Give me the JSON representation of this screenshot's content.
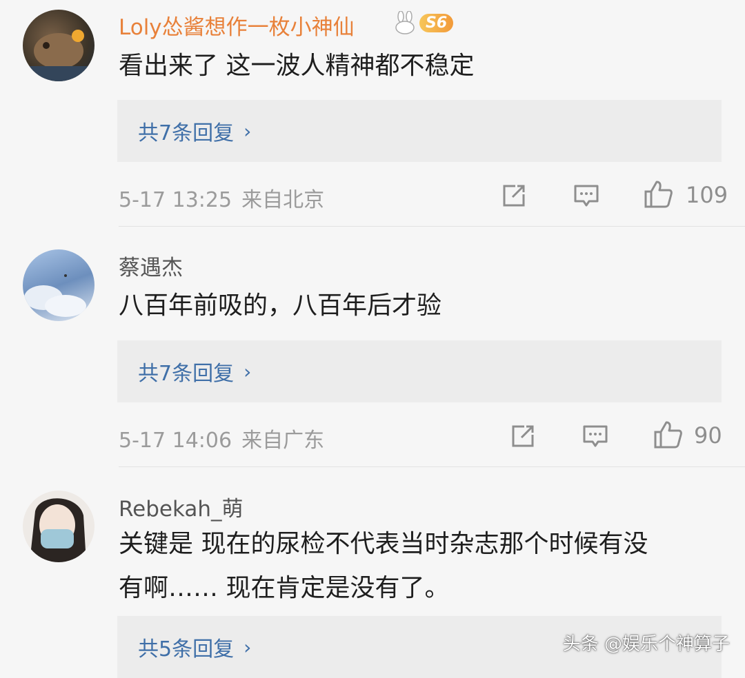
{
  "comments": [
    {
      "username": "Loly怂酱想作一枚小神仙",
      "badge_level": "S6",
      "text": "看出来了 这一波人精神都不稳定",
      "reply_link": "共7条回复",
      "time": "5-17 13:25",
      "location": "来自北京",
      "likes": "109"
    },
    {
      "username": "蔡遇杰",
      "text": "八百年前吸的，八百年后才验",
      "reply_link": "共7条回复",
      "time": "5-17 14:06",
      "location": "来自广东",
      "likes": "90"
    },
    {
      "username": "Rebekah_萌",
      "text_line1": "关键是 现在的尿检不代表当时杂志那个时候有没",
      "text_line2": "有啊…… 现在肯定是没有了。",
      "reply_link": "共5条回复"
    }
  ],
  "watermark": "头条 @娱乐个神算子",
  "icons": [
    "share-icon",
    "comment-icon",
    "like-icon",
    "chevron-right-icon"
  ],
  "colors": {
    "username_vip": "#e8813a",
    "link": "#3f6fa8",
    "meta": "#9b9b9b",
    "reply_bg": "#ececec"
  }
}
